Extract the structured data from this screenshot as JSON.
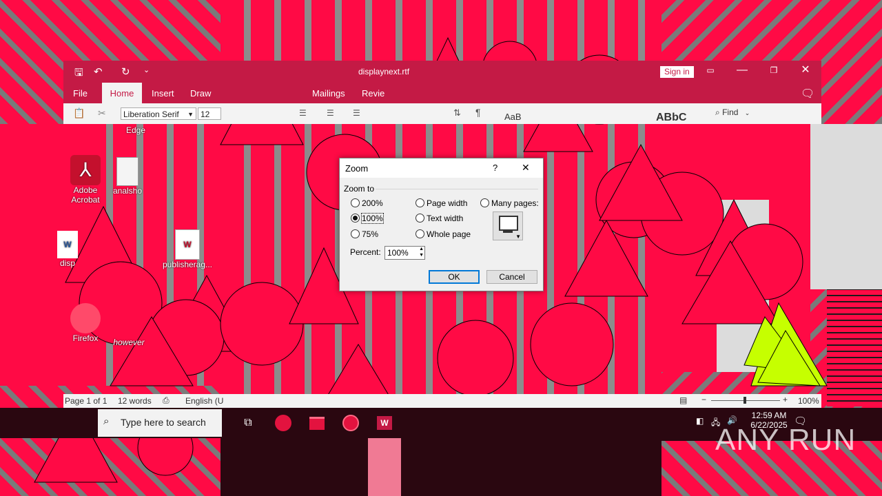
{
  "word": {
    "title": "displaynext.rtf",
    "sign_in": "Sign in",
    "tabs": [
      "File",
      "Home",
      "Insert",
      "Draw",
      "Mailings",
      "Revie"
    ],
    "active_tab": "Home",
    "font_name": "Liberation Serif",
    "font_size": "12",
    "find_label": "Find",
    "styles_preview_1": "AaB",
    "styles_preview_2": "ABbC",
    "status": {
      "page": "Page 1 of 1",
      "words": "12 words",
      "language": "English (U",
      "zoom": "100%"
    }
  },
  "desktop": {
    "icons": [
      {
        "label": "Edge"
      },
      {
        "label": "Adobe Acrobat"
      },
      {
        "label": "analsho"
      },
      {
        "label": "disp"
      },
      {
        "label": "publisherag..."
      },
      {
        "label": "Firefox"
      },
      {
        "label": "however"
      }
    ]
  },
  "dialog": {
    "title": "Zoom",
    "help": "?",
    "close": "✕",
    "section": "Zoom to",
    "options": {
      "p200": "200%",
      "p100": "100%",
      "p75": "75%",
      "page_width": "Page width",
      "text_width": "Text width",
      "whole_page": "Whole page",
      "many_pages": "Many pages:"
    },
    "selected": "100%",
    "percent_label": "Percent:",
    "percent_value": "100%",
    "ok": "OK",
    "cancel": "Cancel"
  },
  "taskbar": {
    "search_placeholder": "Type here to search",
    "clock_time": "12:59 AM",
    "clock_date": "6/22/2025"
  },
  "watermark": "ANY RUN",
  "colors": {
    "accent": "#c41a45",
    "glitch": "#ff0a45",
    "lime": "#c6ff00"
  }
}
